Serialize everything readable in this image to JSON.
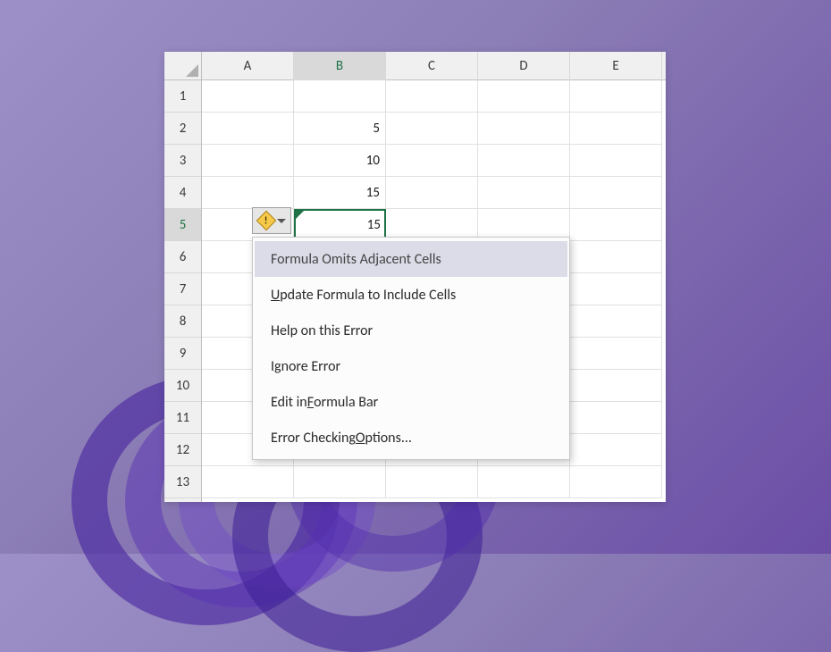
{
  "columns": [
    "A",
    "B",
    "C",
    "D",
    "E"
  ],
  "active_column_index": 1,
  "rows": [
    1,
    2,
    3,
    4,
    5,
    6,
    7,
    8,
    9,
    10,
    11,
    12,
    13
  ],
  "active_row_index": 4,
  "cells": {
    "B2": "5",
    "B3": "10",
    "B4": "15",
    "B5": "15"
  },
  "selected_cell": "B5",
  "menu": {
    "items": [
      {
        "label": "Formula Omits Adjacent Cells",
        "highlighted": true,
        "u": null
      },
      {
        "label": "Update Formula to Include Cells",
        "highlighted": false,
        "u": "U"
      },
      {
        "label": "Help on this Error",
        "highlighted": false,
        "u": null
      },
      {
        "label": "Ignore Error",
        "highlighted": false,
        "u": null
      },
      {
        "label": "Edit in Formula Bar",
        "highlighted": false,
        "u": "F"
      },
      {
        "label": "Error Checking Options...",
        "highlighted": false,
        "u": "O"
      }
    ]
  },
  "icons": {
    "error_warning": "warning"
  }
}
